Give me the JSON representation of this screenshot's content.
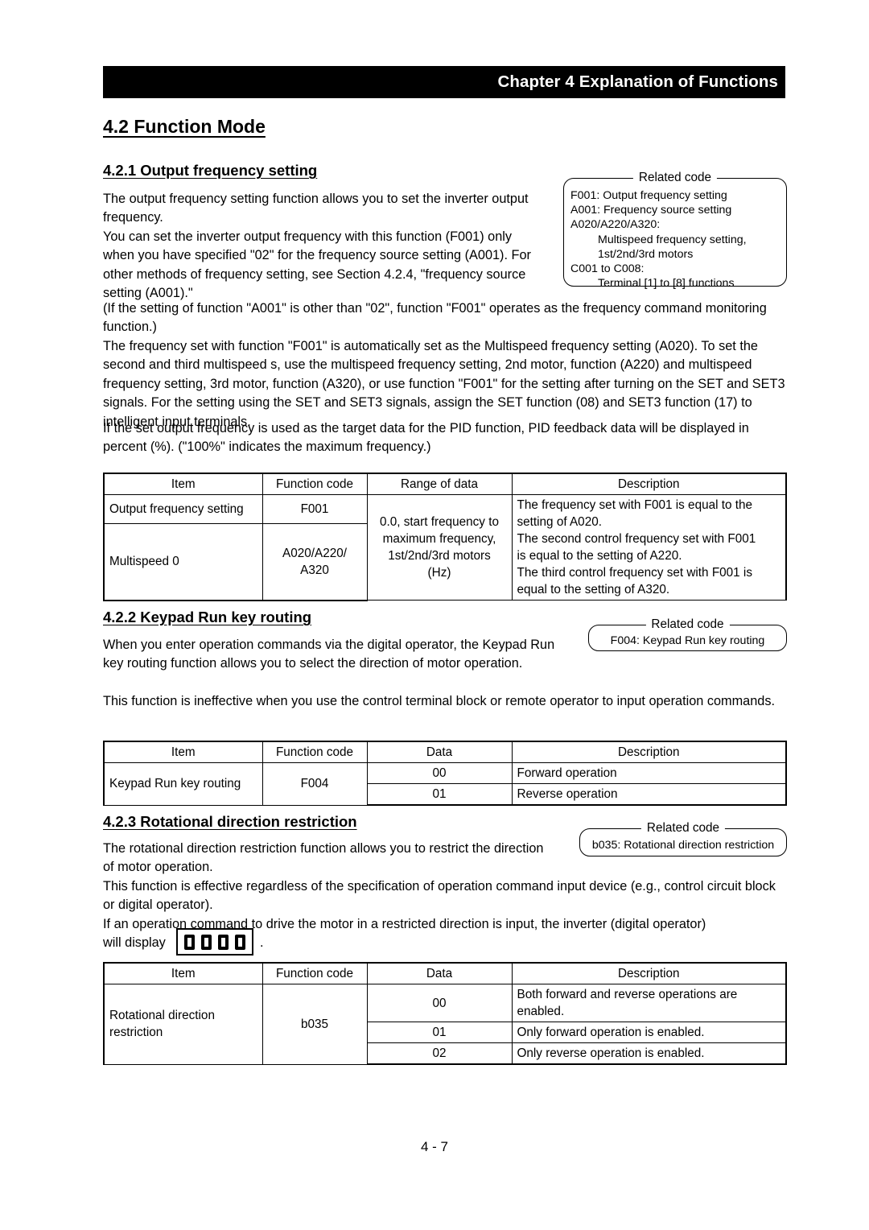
{
  "header": {
    "chapter_title": "Chapter 4 Explanation of Functions"
  },
  "section_main": {
    "heading": "4.2 Function Mode"
  },
  "sections": [
    {
      "heading": "4.2.1 Output frequency setting",
      "paragraphs": [
        "The output frequency setting function allows you to set the inverter output frequency.",
        "You can set the inverter output frequency with this function (F001) only when you have specified \"02\" for the frequency source setting (A001). For other methods of frequency setting, see Section 4.2.4, \"frequency source setting (A001).\"",
        "(If the setting of function \"A001\" is other than \"02\", function \"F001\" operates as the frequency command monitoring function.)",
        "The frequency set with function \"F001\" is automatically set as the Multispeed frequency setting (A020). To set the second and third multispeed s, use the multispeed frequency setting, 2nd motor, function (A220) and multispeed frequency setting, 3rd motor, function (A320), or use function \"F001\" for the setting after turning on the SET and SET3 signals. For the setting using the SET and SET3 signals, assign the SET function (08) and SET3 function (17) to intelligent input terminals.",
        "If the set output frequency is used as the target data for the PID function, PID feedback data will be displayed in percent (%). (\"100%\" indicates the maximum frequency.)"
      ],
      "related_code": {
        "legend": "Related code",
        "lines": [
          {
            "text": "F001: Output frequency setting",
            "indent": 0
          },
          {
            "text": "A001: Frequency source setting",
            "indent": 0
          },
          {
            "text": "A020/A220/A320:",
            "indent": 0
          },
          {
            "text": "Multispeed frequency setting,",
            "indent": 1
          },
          {
            "text": "1st/2nd/3rd motors",
            "indent": 1
          },
          {
            "text": "C001 to C008:",
            "indent": 0
          },
          {
            "text": "Terminal [1] to [8] functions",
            "indent": 1
          }
        ]
      }
    },
    {
      "heading": "4.2.2 Keypad Run key routing",
      "paragraphs": [
        "When you enter operation commands via the digital operator, the Keypad Run key routing function allows you to select the direction of motor operation.",
        "This function is ineffective when you use the control terminal block or remote operator to input operation commands."
      ],
      "related_code": {
        "legend": "Related code",
        "lines": [
          {
            "text": "F004: Keypad Run key routing",
            "indent": 0
          }
        ]
      }
    },
    {
      "heading": "4.2.3 Rotational direction restriction",
      "paragraphs": [
        "The rotational direction restriction function allows you to restrict the direction of motor operation.",
        "This function is effective regardless of the specification of operation command input device (e.g., control circuit block or digital operator).",
        "If an operation command to drive the motor in a restricted direction is input, the inverter (digital operator)"
      ],
      "display_line": {
        "prefix": "will display",
        "display_value": "0000",
        "suffix": "."
      },
      "related_code": {
        "legend": "Related code",
        "lines": [
          {
            "text": "b035: Rotational direction restriction",
            "indent": 0
          }
        ]
      }
    }
  ],
  "tables": {
    "table1": {
      "headers": [
        "Item",
        "Function code",
        "Range of data",
        "Description"
      ],
      "rows": {
        "item_1": "Output frequency setting",
        "code_1": "F001",
        "item_2": "Multispeed 0",
        "code_2": "A020/A220/\nA320",
        "code_2_line1": "A020/A220/",
        "code_2_line2": "A320",
        "range": "0.0, start frequency to maximum frequency, 1st/2nd/3rd motors (Hz)",
        "range_line1": "0.0, start frequency to",
        "range_line2": "maximum frequency,",
        "range_line3": "1st/2nd/3rd motors",
        "range_line4": "(Hz)",
        "description_line1": "The frequency set with F001 is equal to the",
        "description_line2": "setting of A020.",
        "description_line3": "The second control frequency set with F001",
        "description_line4": "is equal to the setting of A220.",
        "description_line5": "The third control frequency set with F001 is",
        "description_line6": "equal to the setting of A320."
      }
    },
    "table2": {
      "headers": [
        "Item",
        "Function code",
        "Data",
        "Description"
      ],
      "item": "Keypad Run key routing",
      "code": "F004",
      "rows": [
        {
          "data": "00",
          "description": "Forward operation"
        },
        {
          "data": "01",
          "description": "Reverse operation"
        }
      ]
    },
    "table3": {
      "headers": [
        "Item",
        "Function code",
        "Data",
        "Description"
      ],
      "item_line1": "Rotational direction",
      "item_line2": "restriction",
      "code": "b035",
      "rows": [
        {
          "data": "00",
          "description": "Both forward and reverse operations are enabled."
        },
        {
          "data": "01",
          "description": "Only forward operation is enabled."
        },
        {
          "data": "02",
          "description": "Only reverse operation is enabled."
        }
      ]
    }
  },
  "footer": {
    "page_number": "4 - 7"
  }
}
